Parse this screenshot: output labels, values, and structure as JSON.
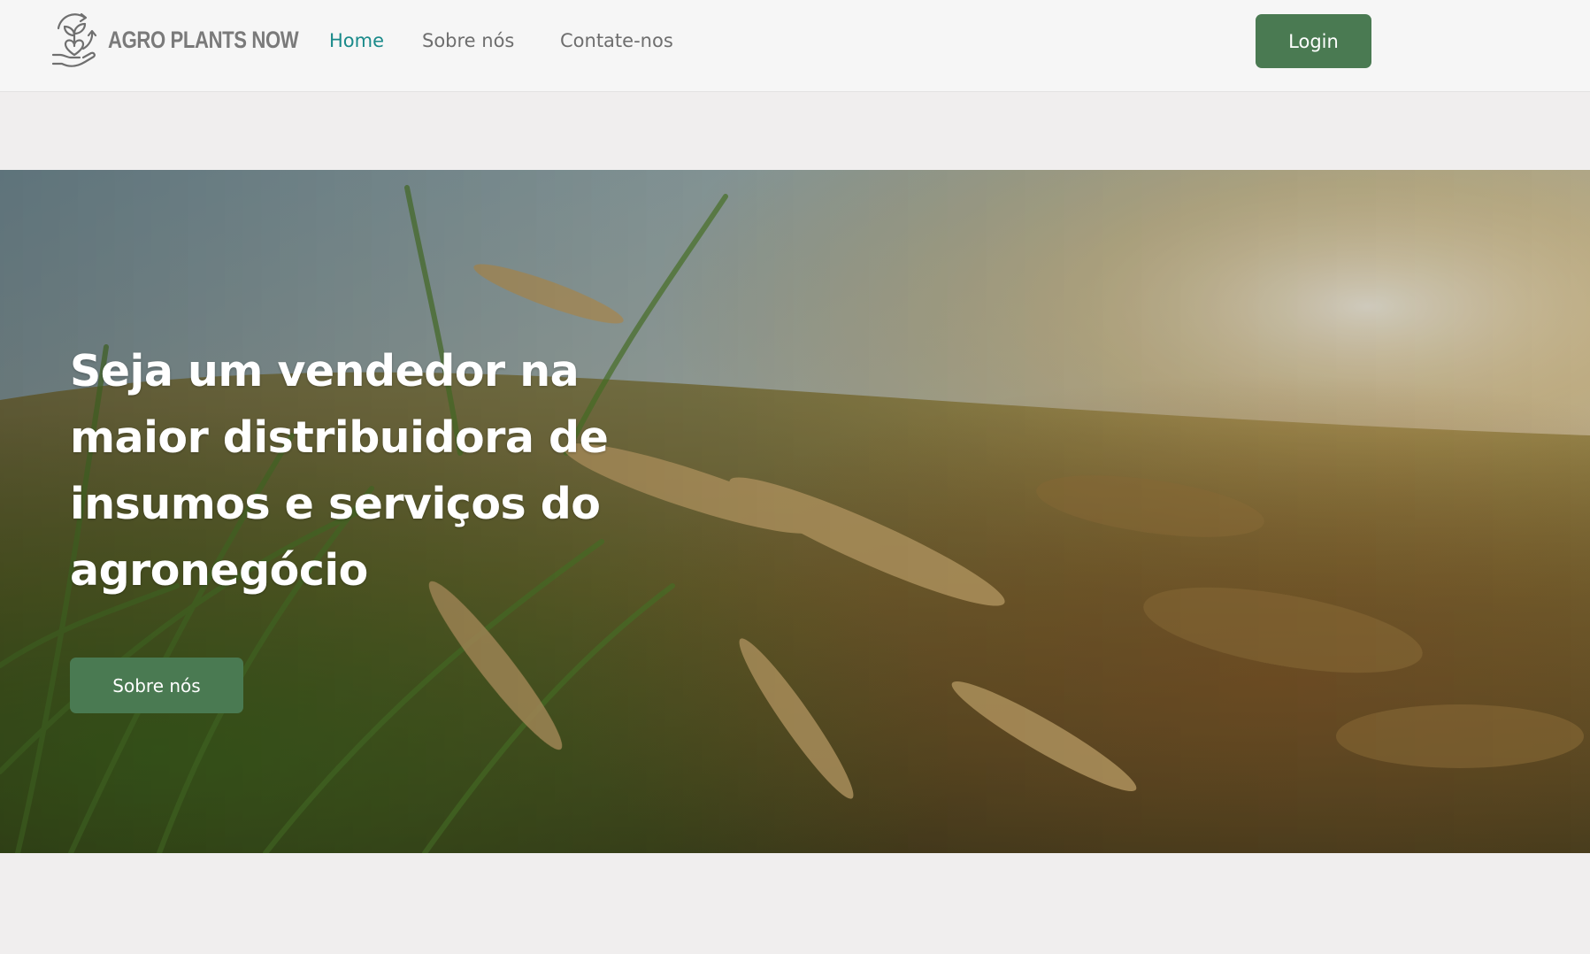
{
  "brand": {
    "name": "AGRO PLANTS NOW",
    "logo_icon": "hand-holding-plant-recycle-icon",
    "text_color": "#7a7a7a"
  },
  "nav": {
    "items": [
      {
        "label": "Home",
        "active": true
      },
      {
        "label": "Sobre nós",
        "active": false
      },
      {
        "label": "Contate-nos",
        "active": false
      }
    ],
    "active_color": "#1a8a8a",
    "inactive_color": "#6e6e6e"
  },
  "header": {
    "login_label": "Login"
  },
  "hero": {
    "title": "Seja um vendedor na maior distribuidora de insumos e serviços do agronegócio",
    "button_label": "Sobre nós",
    "background": "rice-field-sunset-photo"
  },
  "colors": {
    "primary_button": "#4a7a52",
    "page_background": "#f0eeee",
    "header_background": "#f6f6f6"
  }
}
